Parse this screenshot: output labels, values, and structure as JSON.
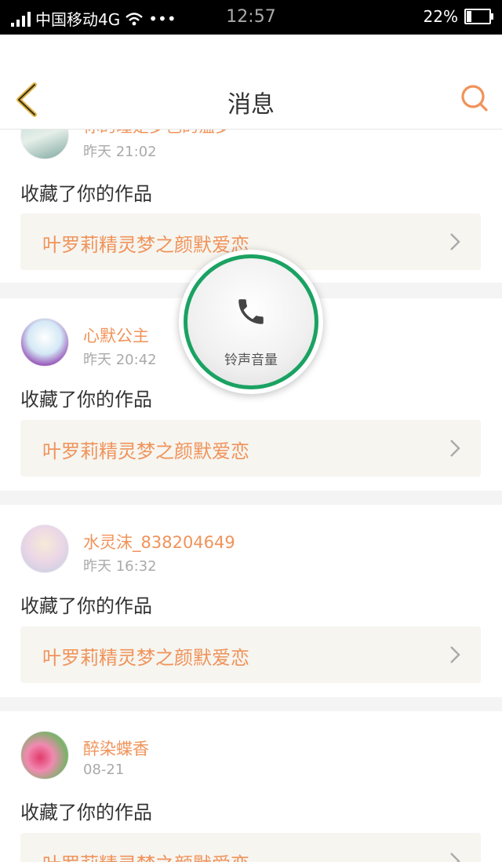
{
  "status_bar": {
    "carrier": "中国移动4G",
    "dots": "•••",
    "time": "12:57",
    "battery": "22%",
    "battery_level": 0.22
  },
  "header": {
    "title": "消息",
    "accent_color": "#f0935a"
  },
  "messages": [
    {
      "name": "你的瞳是梦色的温梦",
      "time": "昨天 21:02",
      "action": "收藏了你的作品",
      "work_title": "叶罗莉精灵梦之颜默爱恋"
    },
    {
      "name": "心默公主",
      "time": "昨天 20:42",
      "action": "收藏了你的作品",
      "work_title": "叶罗莉精灵梦之颜默爱恋"
    },
    {
      "name": "水灵沫_838204649",
      "time": "昨天 16:32",
      "action": "收藏了你的作品",
      "work_title": "叶罗莉精灵梦之颜默爱恋"
    },
    {
      "name": "醉染蝶香",
      "time": "08-21",
      "action": "收藏了你的作品",
      "work_title": "叶罗莉精灵梦之颜默爱恋"
    }
  ],
  "volume_overlay": {
    "label": "铃声音量",
    "ring_color": "#1aa262"
  }
}
